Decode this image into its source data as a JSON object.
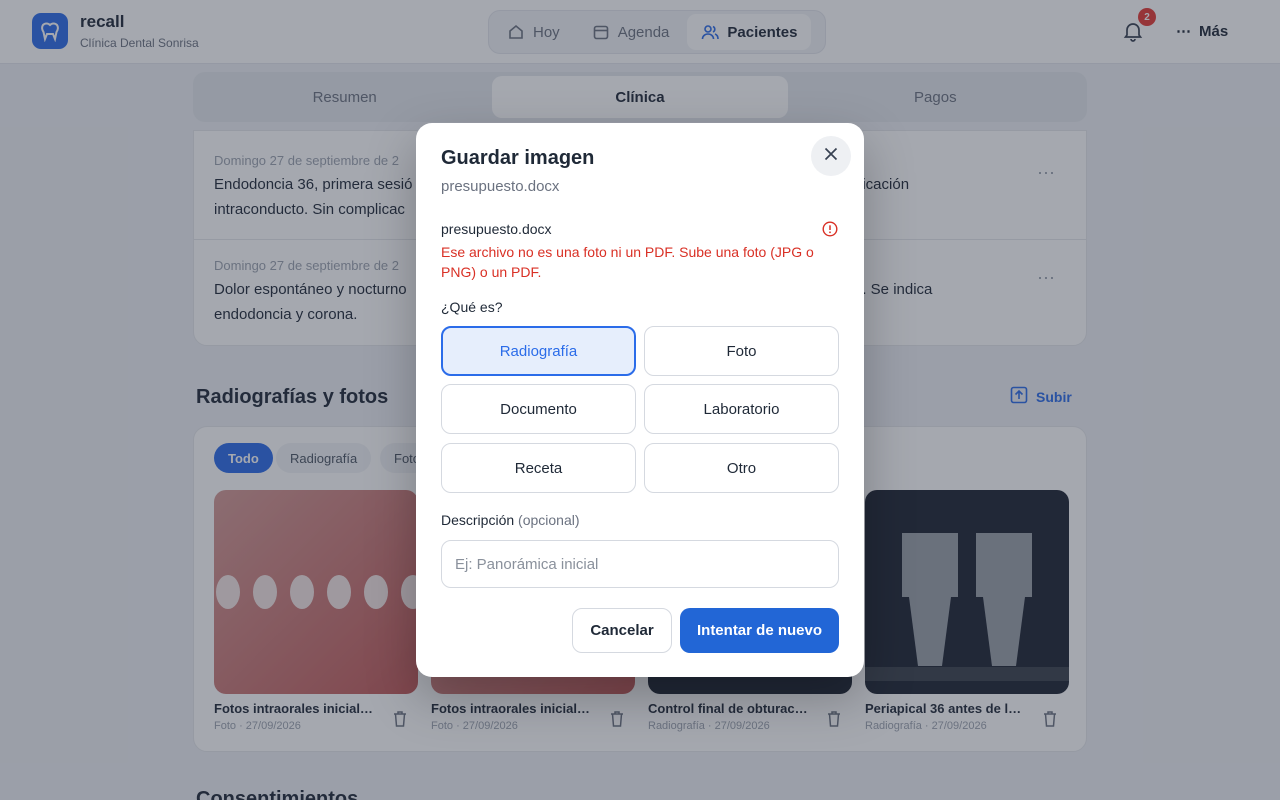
{
  "header": {
    "app_name": "recall",
    "clinic_name": "Clínica Dental Sonrisa",
    "nav": [
      {
        "label": "Hoy",
        "icon": "home-icon"
      },
      {
        "label": "Agenda",
        "icon": "calendar-icon"
      },
      {
        "label": "Pacientes",
        "icon": "users-icon"
      }
    ],
    "notification_count": "2",
    "more_label": "Más"
  },
  "tabs": [
    "Resumen",
    "Clínica",
    "Pagos"
  ],
  "notes": [
    {
      "date": "Domingo 27 de septiembre de 2",
      "text_left": "Endodoncia 36, primera sesió",
      "text_left2": "intraconducto. Sin complicac",
      "text_right": "dicación"
    },
    {
      "date": "Domingo 27 de septiembre de 2",
      "text_left": "Dolor espontáneo y nocturno",
      "text_left2": "endodoncia y corona.",
      "text_right": "e. Se indica"
    }
  ],
  "gallery": {
    "title": "Radiografías y fotos",
    "upload_label": "Subir",
    "filters": [
      "Todo",
      "Radiografía",
      "Foto"
    ],
    "items": [
      {
        "title": "Fotos intraorales inicial…",
        "meta": "Foto · 27/09/2026"
      },
      {
        "title": "Fotos intraorales inicial…",
        "meta": "Foto · 27/09/2026"
      },
      {
        "title": "Control final de obturac…",
        "meta": "Radiografía · 27/09/2026"
      },
      {
        "title": "Periapical 36 antes de l…",
        "meta": "Radiografía · 27/09/2026"
      }
    ],
    "next_section": "Consentimientos"
  },
  "modal": {
    "title": "Guardar imagen",
    "subtitle": "presupuesto.docx",
    "file_name": "presupuesto.docx",
    "error": "Ese archivo no es una foto ni un PDF. Sube una foto (JPG o PNG) o un PDF.",
    "type_label": "¿Qué es?",
    "options": [
      "Radiografía",
      "Foto",
      "Documento",
      "Laboratorio",
      "Receta",
      "Otro"
    ],
    "selected": "Radiografía",
    "desc_label": "Descripción",
    "desc_optional": "(opcional)",
    "desc_placeholder": "Ej: Panorámica inicial",
    "desc_value": "",
    "cancel_label": "Cancelar",
    "retry_label": "Intentar de nuevo"
  },
  "colors": {
    "accent": "#2266d6",
    "error": "#d93025"
  }
}
